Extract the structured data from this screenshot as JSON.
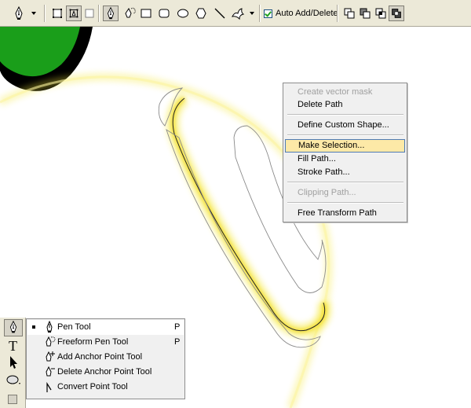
{
  "options_bar": {
    "tool_preset_icon": "pen-icon",
    "path_modes": [
      "shape-layers-icon",
      "paths-icon",
      "fill-pixels-icon"
    ],
    "drawing_tools": [
      "pen-icon",
      "freeform-pen-icon",
      "rectangle-icon",
      "rounded-rectangle-icon",
      "ellipse-icon",
      "polygon-icon",
      "line-icon",
      "custom-shape-icon"
    ],
    "auto_add_delete": {
      "label": "Auto Add/Delete",
      "checked": true
    },
    "combine_modes": [
      "add-to-path-area-icon",
      "subtract-from-path-area-icon",
      "intersect-path-areas-icon",
      "exclude-overlapping-path-areas-icon"
    ]
  },
  "context_menu": {
    "items": [
      {
        "label": "Create vector mask",
        "disabled": true
      },
      {
        "label": "Delete Path"
      },
      {
        "separator": true
      },
      {
        "label": "Define Custom Shape..."
      },
      {
        "separator": true
      },
      {
        "label": "Make Selection...",
        "highlighted": true
      },
      {
        "label": "Fill Path..."
      },
      {
        "label": "Stroke Path..."
      },
      {
        "separator": true
      },
      {
        "label": "Clipping Path...",
        "disabled": true
      },
      {
        "separator": true
      },
      {
        "label": "Free Transform Path"
      }
    ]
  },
  "tools_panel": [
    "pen-icon",
    "type-icon",
    "path-selection-icon",
    "ellipse-icon"
  ],
  "pen_flyout": {
    "items": [
      {
        "label": "Pen Tool",
        "shortcut": "P",
        "selected": true,
        "icon": "pen-icon"
      },
      {
        "label": "Freeform Pen Tool",
        "shortcut": "P",
        "icon": "freeform-pen-icon"
      },
      {
        "label": "Add Anchor Point Tool",
        "shortcut": "",
        "icon": "add-anchor-point-icon"
      },
      {
        "label": "Delete Anchor Point Tool",
        "shortcut": "",
        "icon": "delete-anchor-point-icon"
      },
      {
        "label": "Convert Point Tool",
        "shortcut": "",
        "icon": "convert-point-icon"
      }
    ]
  },
  "colors": {
    "glow": "#f5e83a",
    "shape_green": "#1a9e1a",
    "highlight": "#fde9a7"
  }
}
